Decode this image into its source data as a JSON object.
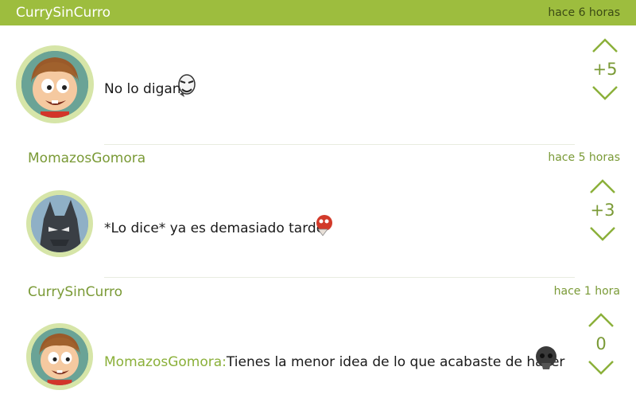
{
  "header": {
    "user": "CurrySinCurro",
    "time": "hace 6 horas"
  },
  "comments": [
    {
      "user": "CurrySinCurro",
      "time": "hace 6 horas",
      "text": "No lo digan",
      "score": "+5"
    },
    {
      "user": "MomazosGomora",
      "time": "hace 5 horas",
      "text": "*Lo dice* ya es demasiado tarde",
      "score": "+3"
    },
    {
      "user": "CurrySinCurro",
      "time": "hace 1 hora",
      "mention": "MomazosGomora:",
      "text": "Tienes la menor idea de lo que acabaste de hacer",
      "score": "0"
    }
  ],
  "colors": {
    "accent": "#9dbd3e",
    "accent_text": "#7a9a36",
    "avatar_ring": "#d6e5a8"
  },
  "icons": {
    "upvote": "chevron-up-icon",
    "downvote": "chevron-down-icon"
  }
}
